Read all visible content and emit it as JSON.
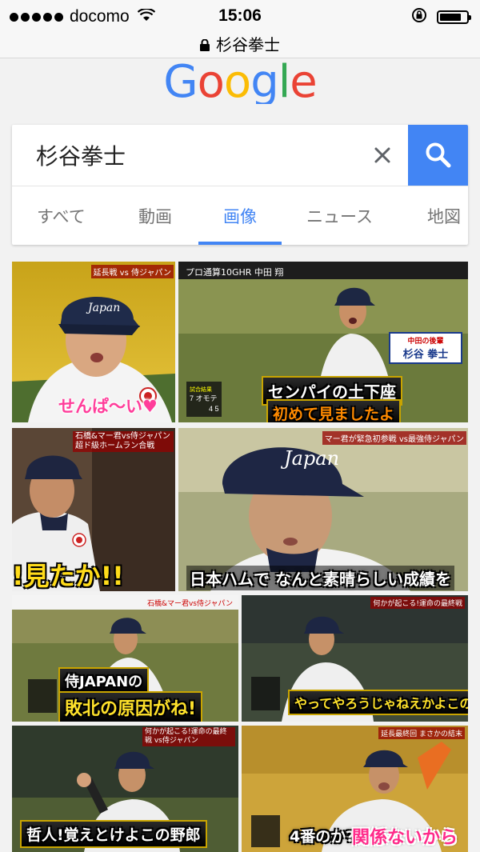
{
  "status": {
    "carrier": "docomo",
    "time": "15:06",
    "battery_level": 0.8
  },
  "browser": {
    "url_text": "杉谷拳士"
  },
  "logo": {
    "letters": [
      {
        "ch": "G",
        "color": "#4285f4"
      },
      {
        "ch": "o",
        "color": "#ea4335"
      },
      {
        "ch": "o",
        "color": "#fbbc05"
      },
      {
        "ch": "g",
        "color": "#4285f4"
      },
      {
        "ch": "l",
        "color": "#34a853"
      },
      {
        "ch": "e",
        "color": "#ea4335"
      }
    ]
  },
  "search": {
    "query": "杉谷拳士"
  },
  "tabs": [
    {
      "label": "すべて",
      "active": false
    },
    {
      "label": "動画",
      "active": false
    },
    {
      "label": "画像",
      "active": true
    },
    {
      "label": "ニュース",
      "active": false
    },
    {
      "label": "地図",
      "active": false
    }
  ],
  "results": {
    "images": [
      {
        "caption": "せんぱ〜い♥",
        "overlay": "延長戦 vs 侍ジャパン"
      },
      {
        "caption_line1": "センパイの土下座",
        "caption_line2": "初めて見ましたよ",
        "overlay": "プロ通算10GHR 中田 翔",
        "name_tag": "杉谷 拳士",
        "name_tag_sub": "中田の後輩"
      },
      {
        "caption": "!見たか!!",
        "overlay": "石橋&マー君vs侍ジャパン 超ド級ホームラン合戦"
      },
      {
        "caption": "日本ハムで なんと素晴らしい成績を",
        "overlay": "マー君が緊急初参戦 vs最強侍ジャパン"
      },
      {
        "caption_line1": "侍JAPANの",
        "caption_line2": "敗北の原因がね!",
        "overlay": "石橋&マー君vs侍ジャパン"
      },
      {
        "caption": "やってやろうじゃねえかよこの野郎!",
        "overlay": "何かが起こる!運命の最終戦"
      },
      {
        "caption": "哲人!覚えとけよこの野郎",
        "overlay": "何かが起こる!運命の最終戦 vs侍ジャパン"
      },
      {
        "caption_a": "4番のか?",
        "caption_b": "関係ないから",
        "overlay": "延長最終回 まさかの結末"
      }
    ]
  },
  "colors": {
    "google_blue": "#4285f4",
    "tab_inactive": "#757575"
  }
}
